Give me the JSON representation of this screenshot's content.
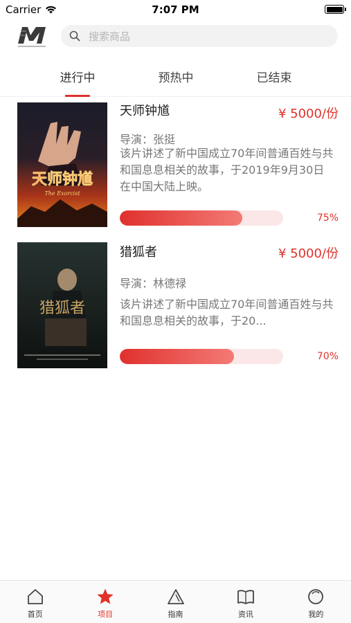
{
  "status_bar": {
    "carrier": "Carrier",
    "time": "7:07 PM"
  },
  "header": {
    "logo_icon": "m-logo-icon",
    "search_placeholder": "搜索商品",
    "search_icon": "search-icon"
  },
  "tabs": [
    {
      "label": "进行中",
      "active": true
    },
    {
      "label": "预热中",
      "active": false
    },
    {
      "label": "已结束",
      "active": false
    }
  ],
  "projects": [
    {
      "title": "天师钟馗",
      "price": "¥ 5000/份",
      "director": "导演：张挺",
      "description": "该片讲述了新中国成立70年间普通百姓与共和国息息相关的故事，于2019年9月30日在中国大陆上映。",
      "progress": 0.75,
      "progress_label": "75%",
      "poster_title": "天师钟馗",
      "poster_subtitle": "The Exorcist"
    },
    {
      "title": "猎狐者",
      "price": "¥ 5000/份",
      "director": "导演：林德禄",
      "description": "该片讲述了新中国成立70年间普通百姓与共和国息息相关的故事，于20...",
      "progress": 0.7,
      "progress_label": "70%",
      "poster_title": "猎狐者"
    }
  ],
  "tabbar": [
    {
      "label": "首页",
      "icon": "home-icon",
      "active": false
    },
    {
      "label": "项目",
      "icon": "star-icon",
      "active": true
    },
    {
      "label": "指南",
      "icon": "compass-icon",
      "active": false
    },
    {
      "label": "资讯",
      "icon": "book-icon",
      "active": false
    },
    {
      "label": "我的",
      "icon": "profile-icon",
      "active": false
    }
  ],
  "colors": {
    "accent": "#e0322b",
    "progress_track": "#fbe7e7"
  }
}
